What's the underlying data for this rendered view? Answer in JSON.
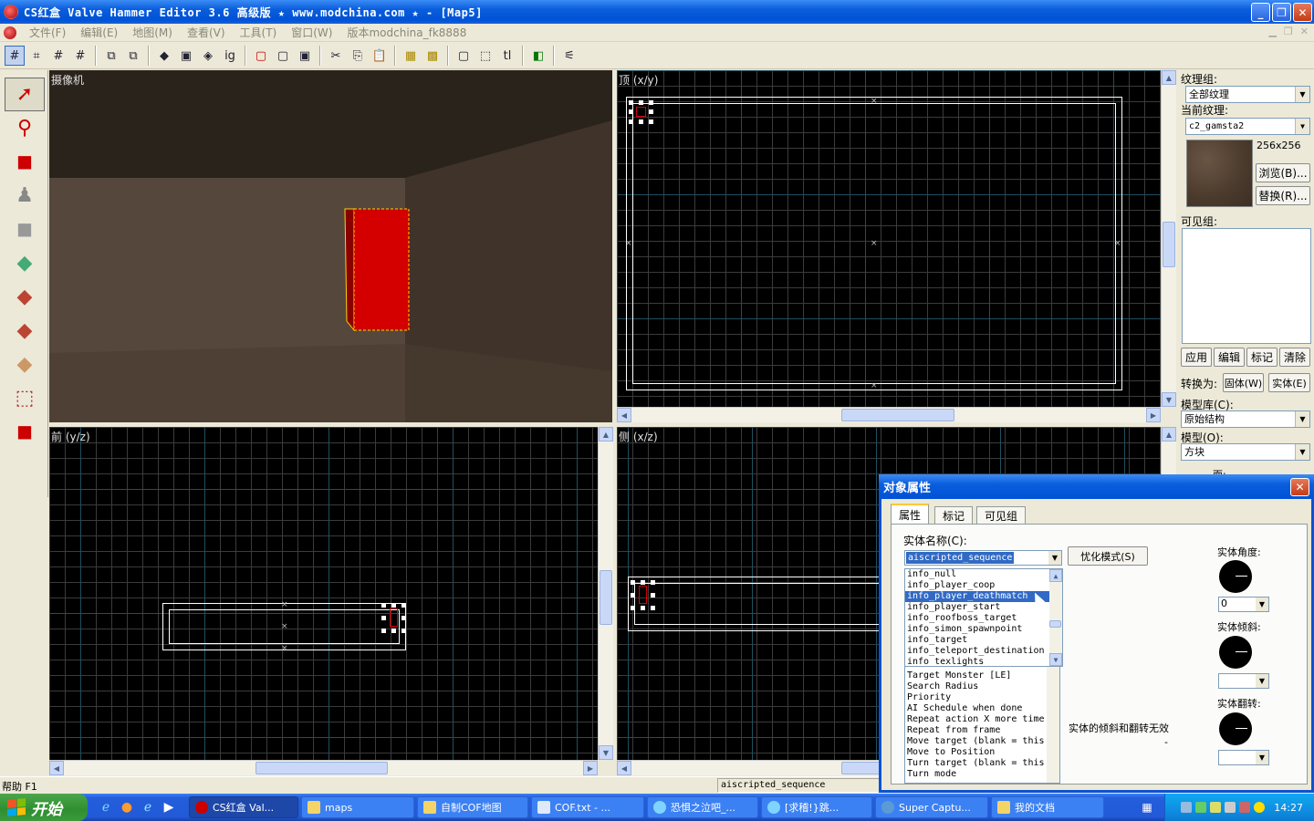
{
  "window": {
    "title": "CS红盒 Valve Hammer Editor 3.6 高级版 ★ www.modchina.com ★ - [Map5]",
    "minimize": "_",
    "maximize": "❐",
    "close": "✕"
  },
  "menubar": {
    "items": [
      "文件(F)",
      "编辑(E)",
      "地图(M)",
      "查看(V)",
      "工具(T)",
      "窗口(W)",
      "版本modchina_fk8888"
    ]
  },
  "viewports": {
    "camera": "摄像机",
    "top": "顶 (x/y)",
    "front": "前 (y/z)",
    "side": "侧 (x/z)"
  },
  "right_panel": {
    "texture_group_label": "纹理组:",
    "texture_group_value": "全部纹理",
    "current_texture_label": "当前纹理:",
    "current_texture_value": "c2_gamsta2",
    "texture_size": "256x256",
    "browse_button": "浏览(B)...",
    "replace_button": "替换(R)...",
    "visgroup_label": "可见组:",
    "apply_button": "应用",
    "edit_button": "编辑",
    "mark_button": "标记",
    "clear_button": "清除",
    "convert_label": "转换为:",
    "to_world_button": "固体(W)",
    "to_entity_button": "实体(E)",
    "prefab_lib_label": "模型库(C):",
    "prefab_lib_value": "原始结构",
    "prefab_label": "模型(O):",
    "prefab_value": "方块",
    "faces_label": "面:"
  },
  "statusbar": {
    "help": "帮助 F1",
    "selection": "aiscripted_sequence"
  },
  "dialog": {
    "title": "对象属性",
    "tabs": [
      "属性",
      "标记",
      "可见组"
    ],
    "class_label": "实体名称(C):",
    "class_value": "aiscripted_sequence",
    "smart_edit_button": "忧化模式(S)",
    "class_options": [
      "info_null",
      "info_player_coop",
      "info_player_deathmatch",
      "info_player_start",
      "info_roofboss_target",
      "info_simon_spawnpoint",
      "info_target",
      "info_teleport_destination",
      "info_texlights"
    ],
    "selected_option_index": 2,
    "keyvalues": [
      "Target Monster [LE]",
      "Search Radius",
      "Priority",
      "AI Schedule when done",
      "Repeat action X more time",
      "Repeat from frame",
      "Move target (blank = this",
      "Move to Position",
      "Turn target (blank = this",
      "Turn mode"
    ],
    "angles_label": "实体角度:",
    "angles_value": "0",
    "pitch_label": "实体倾斜:",
    "roll_label": "实体翻转:",
    "note": "实体的倾斜和翻转无效",
    "dash": "-"
  },
  "taskbar": {
    "start": "开始",
    "tasks": [
      "CS红盒 Val...",
      "maps",
      "自制COF地图",
      "COF.txt - ...",
      "恐惧之泣吧_...",
      "[求稽!}跳...",
      "Super Captu...",
      "我的文档"
    ],
    "active_task_index": 0,
    "clock": "14:27"
  },
  "colors": {
    "xp_blue": "#0a5ddc",
    "selection_red": "#d40000",
    "start_green": "#2f8e2f"
  }
}
